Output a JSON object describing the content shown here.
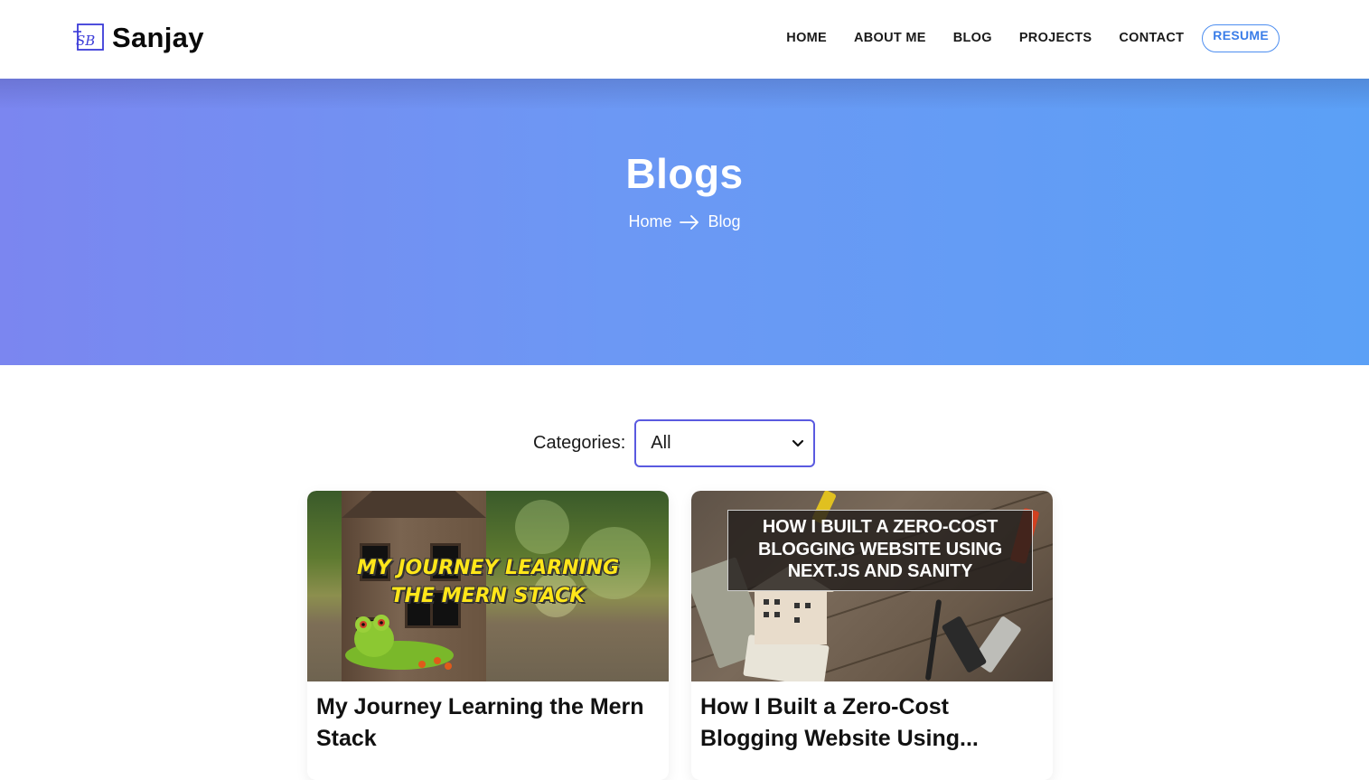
{
  "header": {
    "logo_mark": "SB",
    "logo_text": "Sanjay",
    "nav": [
      "HOME",
      "ABOUT ME",
      "BLOG",
      "PROJECTS",
      "CONTACT"
    ],
    "resume_label": "RESUME"
  },
  "hero": {
    "title": "Blogs",
    "breadcrumb": {
      "home": "Home",
      "current": "Blog"
    }
  },
  "filter": {
    "label": "Categories:",
    "selected": "All"
  },
  "posts": [
    {
      "image_text": "MY JOURNEY LEARNING THE MERN STACK",
      "title": "My Journey Learning the Mern Stack"
    },
    {
      "image_text": "HOW I BUILT A ZERO-COST BLOGGING WEBSITE USING NEXT.JS AND SANITY",
      "title": "How I Built a Zero-Cost Blogging Website Using..."
    }
  ],
  "colors": {
    "hero_start": "#7b86f0",
    "hero_end": "#5ba0f6",
    "accent": "#3a7de8",
    "select_border": "#5a5ae0"
  }
}
